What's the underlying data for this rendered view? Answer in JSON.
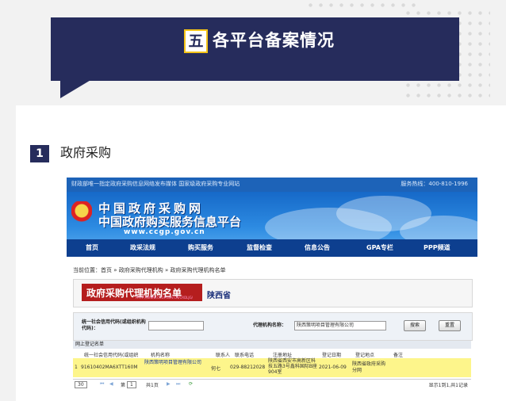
{
  "section": {
    "number": "五",
    "title": "各平台备案情况"
  },
  "subsection": {
    "number": "1",
    "title": "政府采购"
  },
  "site": {
    "top_left": "财政部唯一指定政府采购信息网络发布媒体 国家级政府采购专业网站",
    "hotline": "服务热线：400-810-1996",
    "logo_line1": "中国政府采购网",
    "logo_line2": "中国政府购买服务信息平台",
    "logo_url": "www.ccgp.gov.cn",
    "nav": [
      "首页",
      "政采法规",
      "购买服务",
      "监督检查",
      "信息公告",
      "GPA专栏",
      "PPP频道"
    ],
    "breadcrumb": "当前位置：首页 » 政府采购代理机构 » 政府采购代理机构名单",
    "registry_title": "政府采购代理机构名单",
    "registry_sub": "HTTP://WWW.CCGP.GOV.CN/CRDLJG/",
    "registry_province": "陕西省",
    "filter": {
      "credit_label": "统一社会信用代码(或组织机构代码)：",
      "credit_value": "",
      "name_label": "代理机构名称：",
      "name_value": "陕西策明项目管理有限公司",
      "search_btn": "搜索",
      "reset_btn": "重置"
    },
    "list_title": "网上登记名单",
    "table": {
      "headers": [
        "统一社会信用代码(或组织",
        "机构名称",
        "联系人",
        "联系电话",
        "注册地址",
        "登记日期",
        "登记地点",
        "备注"
      ],
      "row": {
        "index": "1",
        "code": "91610402MA6XTT160M",
        "name": "陕西策明项目管理有限公司",
        "contact": "何七",
        "phone": "029-88212028",
        "address": "陕西省西安市高新区科技五路3号鑫科国际B座904室",
        "date": "2021-06-09",
        "place": "陕西省政府采购分网",
        "note": ""
      }
    },
    "pager": {
      "page_size": "30",
      "page_label": "第",
      "page_value": "1",
      "total_pages": "共1页",
      "summary": "显示1到1,共1记录"
    }
  }
}
